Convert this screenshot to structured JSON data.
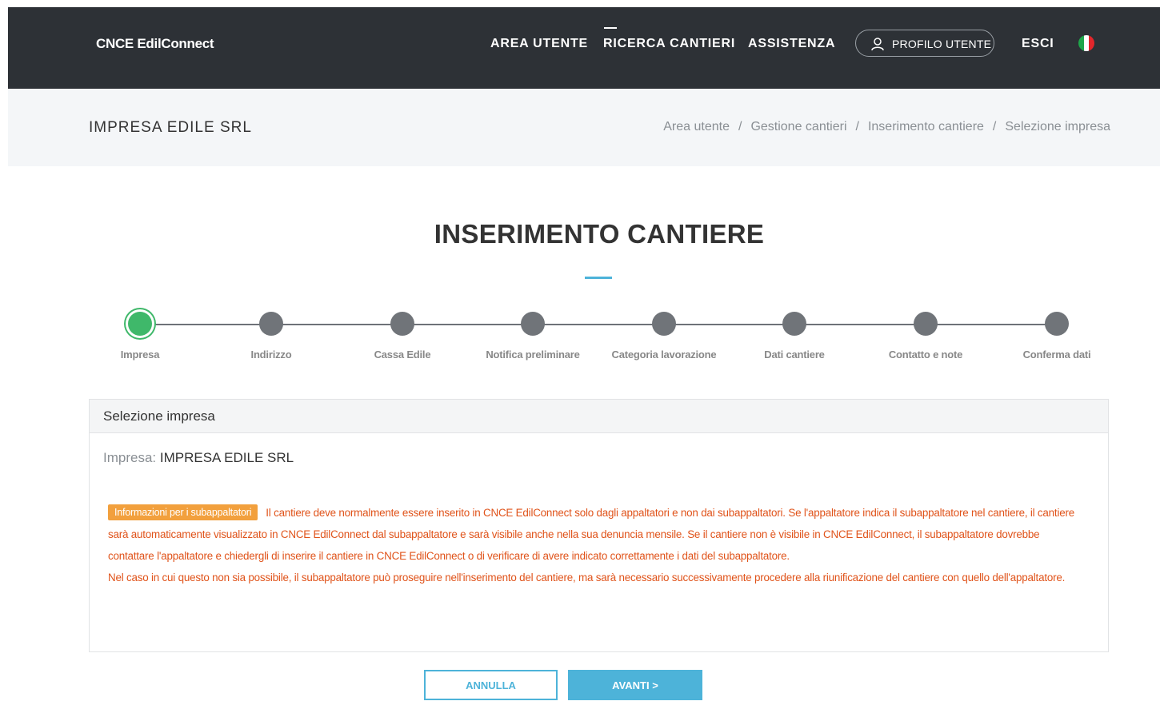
{
  "header": {
    "brand": "CNCE EdilConnect",
    "nav": {
      "area_utente": "AREA UTENTE",
      "ricerca_cantieri": "RICERCA CANTIERI",
      "assistenza": "ASSISTENZA",
      "profilo_utente": "PROFILO UTENTE",
      "esci": "ESCI"
    },
    "active_nav": "RICERCA CANTIERI",
    "icons": {
      "profile": "user-icon",
      "language": "italy-flag-icon"
    },
    "flag_colors": [
      "#1ea64a",
      "#ffffff",
      "#e3262b"
    ]
  },
  "subheader": {
    "company": "IMPRESA EDILE SRL",
    "breadcrumb": [
      "Area utente",
      "Gestione cantieri",
      "Inserimento cantiere",
      "Selezione impresa"
    ],
    "separator": "/"
  },
  "main": {
    "title": "INSERIMENTO CANTIERE",
    "steps": [
      {
        "label": "Impresa",
        "state": "active"
      },
      {
        "label": "Indirizzo",
        "state": "pending"
      },
      {
        "label": "Cassa Edile",
        "state": "pending"
      },
      {
        "label": "Notifica preliminare",
        "state": "pending"
      },
      {
        "label": "Categoria lavorazione",
        "state": "pending"
      },
      {
        "label": "Dati cantiere",
        "state": "pending"
      },
      {
        "label": "Contatto e note",
        "state": "pending"
      },
      {
        "label": "Conferma dati",
        "state": "pending"
      }
    ],
    "panel": {
      "title": "Selezione impresa",
      "impresa_label": "Impresa:",
      "impresa_value": "IMPRESA EDILE SRL",
      "notice_badge": "Informazioni per i subappaltatori",
      "notice_text_1": "Il cantiere deve normalmente essere inserito in CNCE EdilConnect solo dagli appaltatori e non dai subappaltatori. Se l'appaltatore indica il subappaltatore nel cantiere, il cantiere sarà automaticamente visualizzato in CNCE EdilConnect dal subappaltatore e sarà visibile anche nella sua denuncia mensile. Se il cantiere non è visibile in CNCE EdilConnect, il subappaltatore dovrebbe contattare l'appaltatore e chiedergli di inserire il cantiere in CNCE EdilConnect o di verificare di avere indicato correttamente i dati del subappaltatore.",
      "notice_text_2": "Nel caso in cui questo non sia possibile, il subappaltatore può proseguire nell'inserimento del cantiere, ma sarà necessario successivamente procedere alla riunificazione del cantiere con quello dell'appaltatore."
    },
    "buttons": {
      "cancel": "ANNULLA",
      "next": "AVANTI >"
    }
  },
  "colors": {
    "navbar_bg": "#2d3136",
    "accent": "#4db3d9",
    "step_active": "#3fb86a",
    "step_pending": "#707479",
    "warning_text": "#e0531a",
    "warning_badge": "#f2a03d"
  }
}
